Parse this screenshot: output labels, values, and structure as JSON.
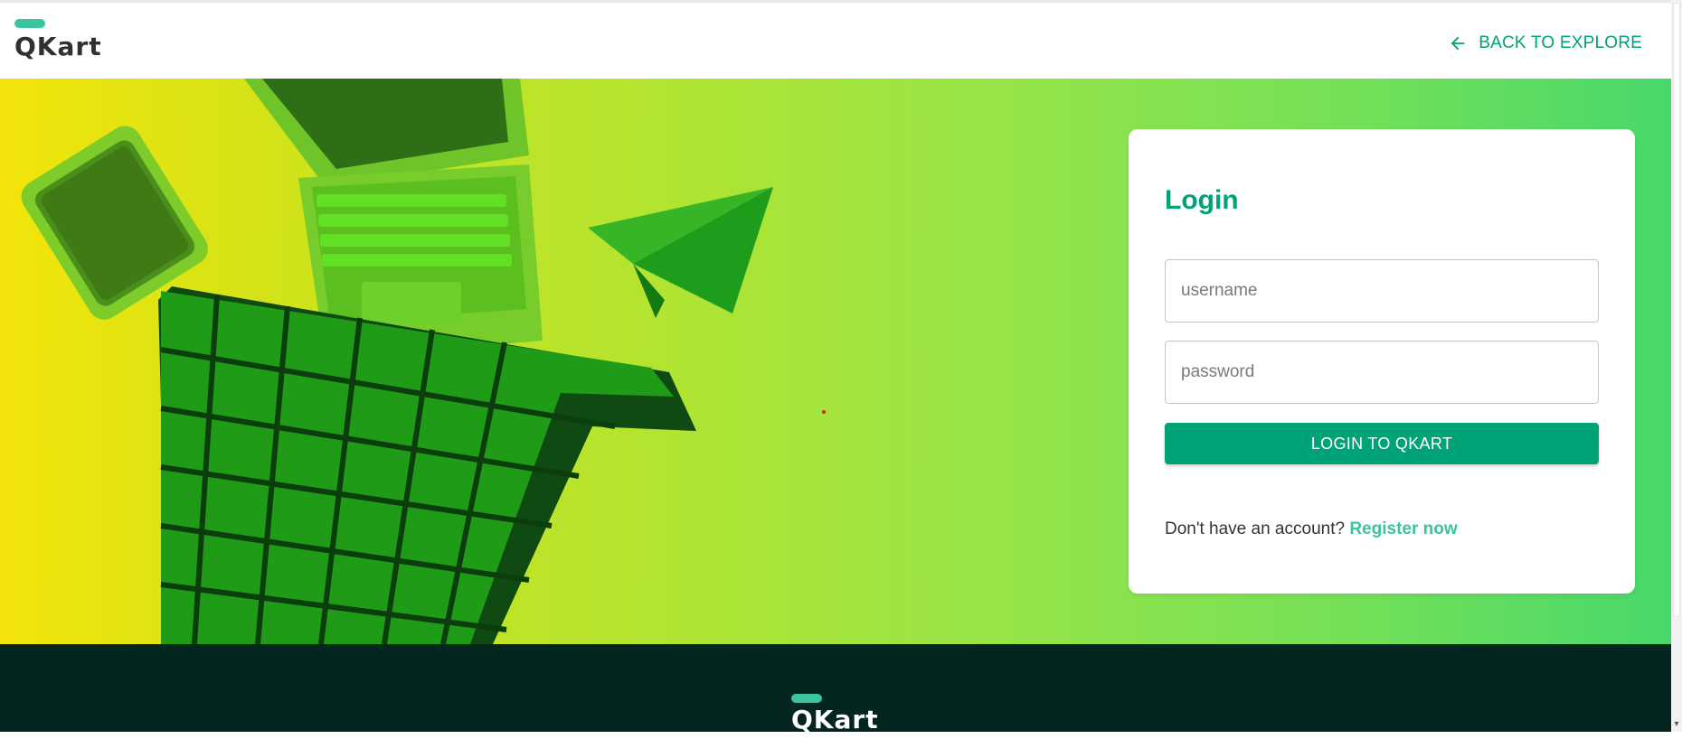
{
  "header": {
    "logo_text": "QKart",
    "back_label": "BACK TO EXPLORE"
  },
  "login": {
    "title": "Login",
    "username_placeholder": "username",
    "password_placeholder": "password",
    "submit_label": "LOGIN TO QKART",
    "register_prompt": "Don't have an account?",
    "register_link": "Register now"
  },
  "footer": {
    "logo_text": "QKart"
  },
  "icons": [
    "arrow-left-icon",
    "chevron-down-icon"
  ],
  "colors": {
    "brand": "#00a278",
    "brand_light": "#3cc3a0",
    "footer_bg": "#052620"
  }
}
